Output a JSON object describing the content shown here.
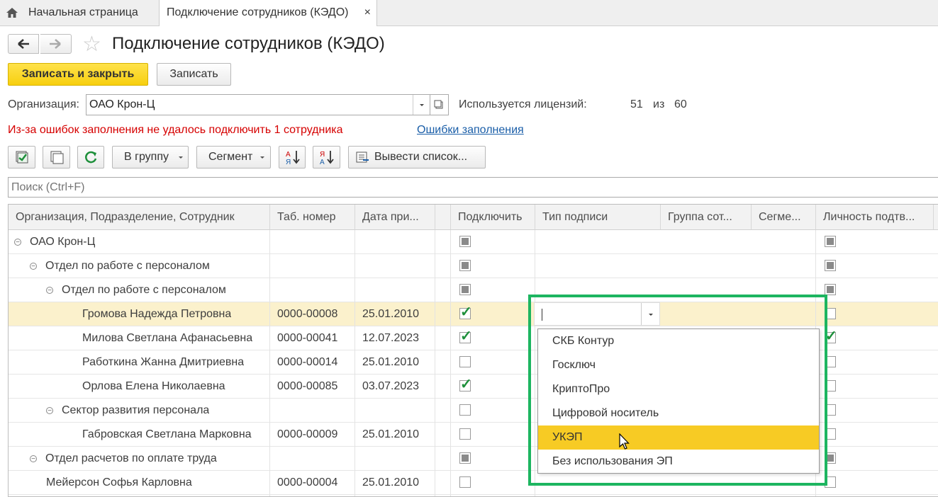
{
  "tabs": {
    "home_label": "Начальная страница",
    "active_label": "Подключение сотрудников (КЭДО)",
    "close_glyph": "×"
  },
  "page": {
    "title": "Подключение сотрудников (КЭДО)"
  },
  "actions": {
    "save_close": "Записать и закрыть",
    "save": "Записать"
  },
  "org": {
    "label": "Организация:",
    "value": "ОАО Крон-Ц"
  },
  "licenses": {
    "label": "Используется лицензий:",
    "used": "51",
    "of": "из",
    "total": "60"
  },
  "errors": {
    "message": "Из-за ошибок заполнения не удалось подключить 1 сотрудника",
    "link": "Ошибки заполнения"
  },
  "toolbar": {
    "group_btn": "В группу",
    "segment_btn": "Сегмент",
    "export_btn": "Вывести список..."
  },
  "search": {
    "placeholder": "Поиск (Ctrl+F)"
  },
  "table": {
    "columns": [
      "Организация, Подразделение, Сотрудник",
      "Таб. номер",
      "Дата при...",
      "",
      "Подключить",
      "Тип подписи",
      "Группа сот...",
      "Сегме...",
      "Личность подтв..."
    ],
    "rows": [
      {
        "name": "ОАО Крон-Ц",
        "level": 0,
        "group": true,
        "tab": "",
        "date": "",
        "connect": "ind",
        "identity": "ind"
      },
      {
        "name": "Отдел по работе с персоналом",
        "level": 1,
        "group": true,
        "tab": "",
        "date": "",
        "connect": "ind",
        "identity": "ind"
      },
      {
        "name": "Отдел по работе с персоналом",
        "level": 2,
        "group": true,
        "tab": "",
        "date": "",
        "connect": "ind",
        "identity": "ind"
      },
      {
        "name": "Громова Надежда Петровна",
        "level": 3,
        "group": false,
        "tab": "0000-00008",
        "date": "25.01.2010",
        "connect": "chk",
        "identity": "off",
        "selected": true
      },
      {
        "name": "Милова Светлана Афанасьевна",
        "level": 3,
        "group": false,
        "tab": "0000-00041",
        "date": "12.07.2023",
        "connect": "chk",
        "identity": "chk"
      },
      {
        "name": "Работкина Жанна Дмитриевна",
        "level": 3,
        "group": false,
        "tab": "0000-00014",
        "date": "25.01.2010",
        "connect": "off",
        "identity": "off"
      },
      {
        "name": "Орлова Елена Николаевна",
        "level": 3,
        "group": false,
        "tab": "0000-00085",
        "date": "03.07.2023",
        "connect": "chk",
        "identity": "off"
      },
      {
        "name": "Сектор развития персонала",
        "level": 2,
        "group": true,
        "tab": "",
        "date": "",
        "connect": "off",
        "identity": "off"
      },
      {
        "name": "Габровская Светлана Марковна",
        "level": 3,
        "group": false,
        "tab": "0000-00009",
        "date": "25.01.2010",
        "connect": "off",
        "identity": "off"
      },
      {
        "name": "Отдел расчетов по оплате труда",
        "level": 1,
        "group": true,
        "tab": "",
        "date": "",
        "connect": "ind",
        "identity": "ind"
      },
      {
        "name": "Мейерсон Софья Карловна",
        "level": 2,
        "group": false,
        "tab": "0000-00004",
        "date": "25.01.2010",
        "connect": "off",
        "identity": "off"
      }
    ]
  },
  "signature_dropdown": {
    "current_value": "",
    "options": [
      "СКБ Контур",
      "Госключ",
      "КриптоПро",
      "Цифровой носитель",
      "УКЭП",
      "Без использования ЭП"
    ],
    "highlighted": "УКЭП"
  },
  "colors": {
    "primary_button": "#f7cf0f",
    "error_text": "#d60000",
    "link": "#1a5ea8",
    "highlight_frame": "#1db560",
    "selected_option": "#f7cb24",
    "selected_row": "#fbf1cc"
  }
}
